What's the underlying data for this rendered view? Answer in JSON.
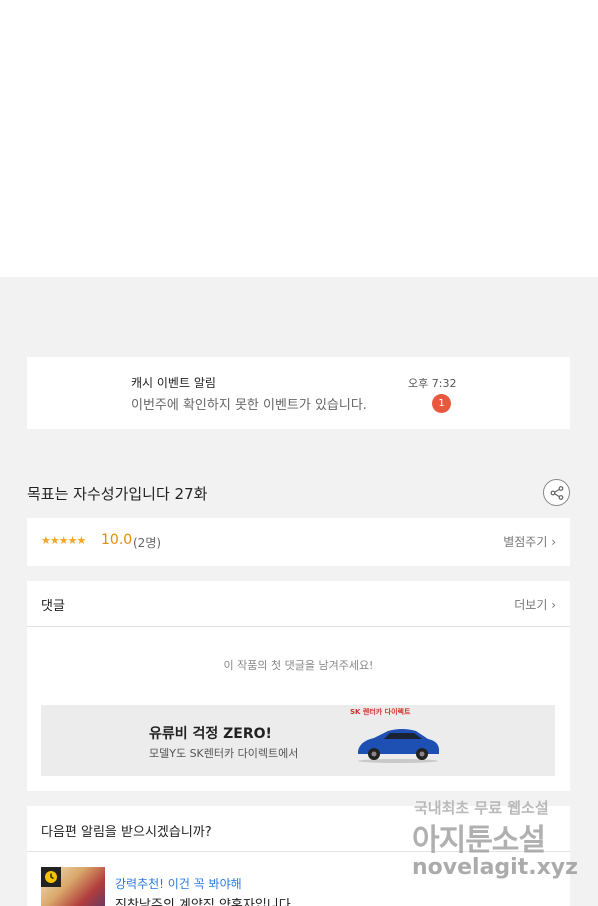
{
  "notification": {
    "title": "캐시 이벤트 알림",
    "message": "이번주에 확인하지 못한 이벤트가 있습니다.",
    "time": "오후 7:32",
    "badge": "1"
  },
  "episode": {
    "title": "목표는 자수성가입니다 27화",
    "share_icon": "share-icon"
  },
  "rating": {
    "stars": "★★★★★",
    "score": "10.0",
    "count": "(2명)",
    "rate_button": "별점주기 ›"
  },
  "comments": {
    "label": "댓글",
    "more": "더보기 ›",
    "empty_text": "이 작품의 첫 댓글을 남겨주세요!"
  },
  "ad": {
    "title": "유류비 걱정 ZERO!",
    "subtitle": "모델Y도 SK렌터카 다이렉트에서",
    "logo": "SK 렌터카 다이렉트"
  },
  "next_episode": {
    "question": "다음편 알림을 받으시겠습니까?",
    "recommend_label": "강력추천! 이건 꼭 봐야해",
    "recommend_title": "진찬남주의 계약직 약혼자입니다"
  },
  "watermark": {
    "line1": "국내최초 무료 웹소설",
    "line2": "아지툰소설",
    "line3": "novelagit.xyz"
  },
  "colors": {
    "badge": "#e9573f",
    "star": "#f5a623",
    "score": "#e58d00",
    "link_blue": "#2a7ae2",
    "page_bg": "#f2f2f2"
  }
}
